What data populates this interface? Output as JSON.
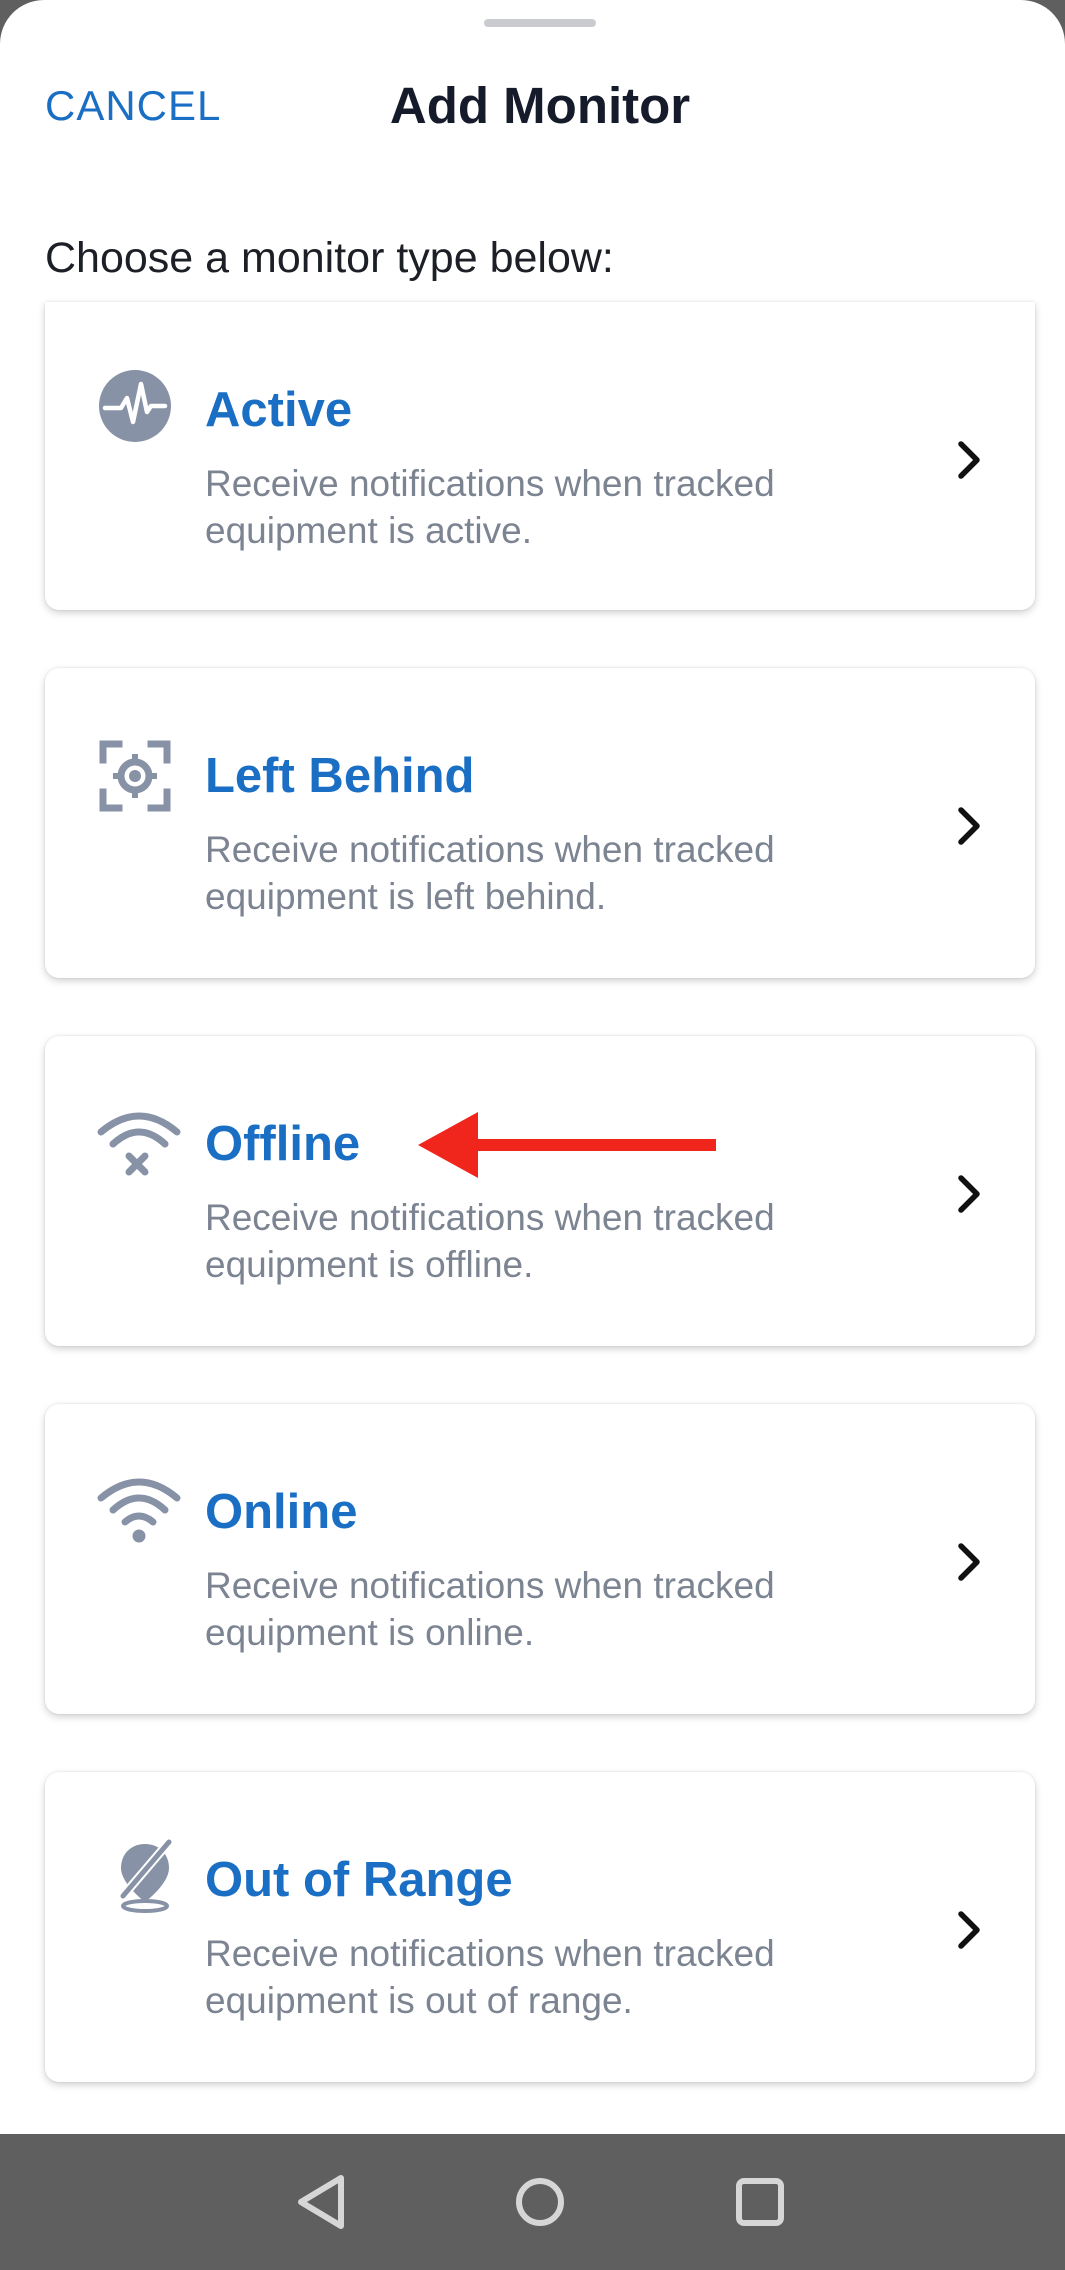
{
  "header": {
    "cancel_label": "CANCEL",
    "title": "Add Monitor"
  },
  "subtitle": "Choose a monitor type below:",
  "monitors": [
    {
      "title": "Active",
      "description": "Receive notifications when tracked equipment is active.",
      "icon": "activity-pulse-icon"
    },
    {
      "title": "Left Behind",
      "description": "Receive notifications when tracked equipment is left behind.",
      "icon": "focus-target-icon"
    },
    {
      "title": "Offline",
      "description": "Receive notifications when tracked equipment is offline.",
      "icon": "wifi-off-icon"
    },
    {
      "title": "Online",
      "description": "Receive notifications when tracked equipment is online.",
      "icon": "wifi-icon"
    },
    {
      "title": "Out of Range",
      "description": "Receive notifications when tracked equipment is out of range.",
      "icon": "location-off-icon"
    }
  ],
  "colors": {
    "accent": "#1a6fc4",
    "icon_gray": "#8792a7",
    "description_gray": "#7c8492",
    "annotation_arrow": "#f0261d",
    "nav_bar": "#5f5f5f"
  },
  "navigation": {
    "back": "back-triangle-icon",
    "home": "home-circle-icon",
    "recents": "recents-square-icon"
  }
}
